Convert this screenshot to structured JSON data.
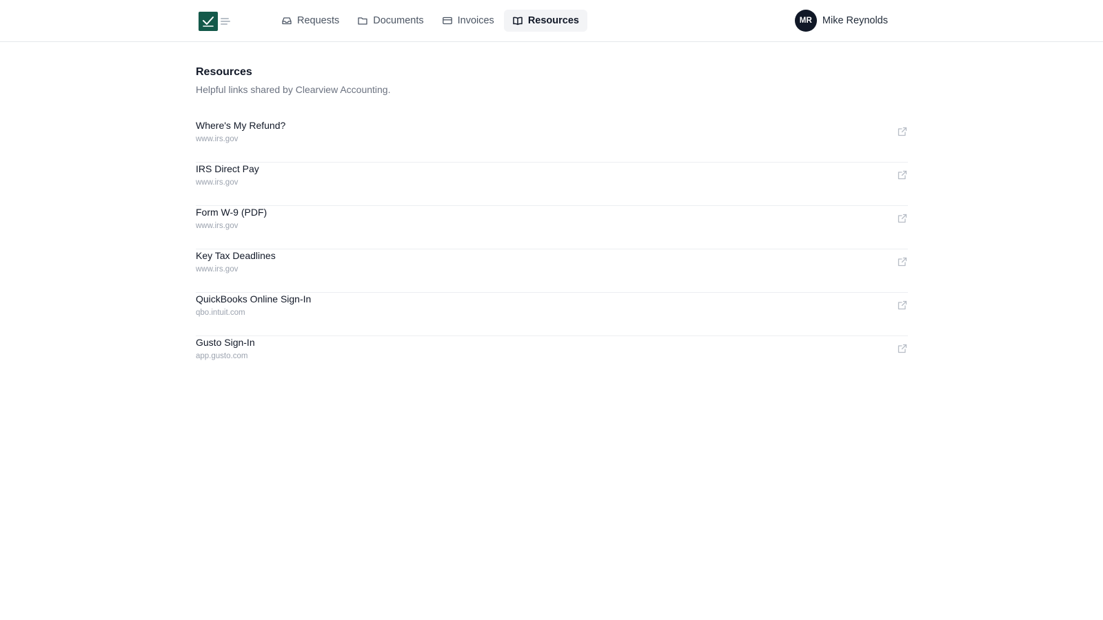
{
  "brand": {
    "color": "#14594a"
  },
  "nav": {
    "items": [
      {
        "label": "Requests",
        "icon": "inbox-icon"
      },
      {
        "label": "Documents",
        "icon": "folder-icon"
      },
      {
        "label": "Invoices",
        "icon": "credit-card-icon"
      },
      {
        "label": "Resources",
        "icon": "book-open-icon",
        "active": true
      }
    ]
  },
  "user": {
    "initials": "MR",
    "name": "Mike Reynolds"
  },
  "page": {
    "title": "Resources",
    "subtitle": "Helpful links shared by Clearview Accounting."
  },
  "resources": [
    {
      "title": "Where's My Refund?",
      "url": "www.irs.gov"
    },
    {
      "title": "IRS Direct Pay",
      "url": "www.irs.gov"
    },
    {
      "title": "Form W-9 (PDF)",
      "url": "www.irs.gov"
    },
    {
      "title": "Key Tax Deadlines",
      "url": "www.irs.gov"
    },
    {
      "title": "QuickBooks Online Sign-In",
      "url": "qbo.intuit.com"
    },
    {
      "title": "Gusto Sign-In",
      "url": "app.gusto.com"
    }
  ]
}
